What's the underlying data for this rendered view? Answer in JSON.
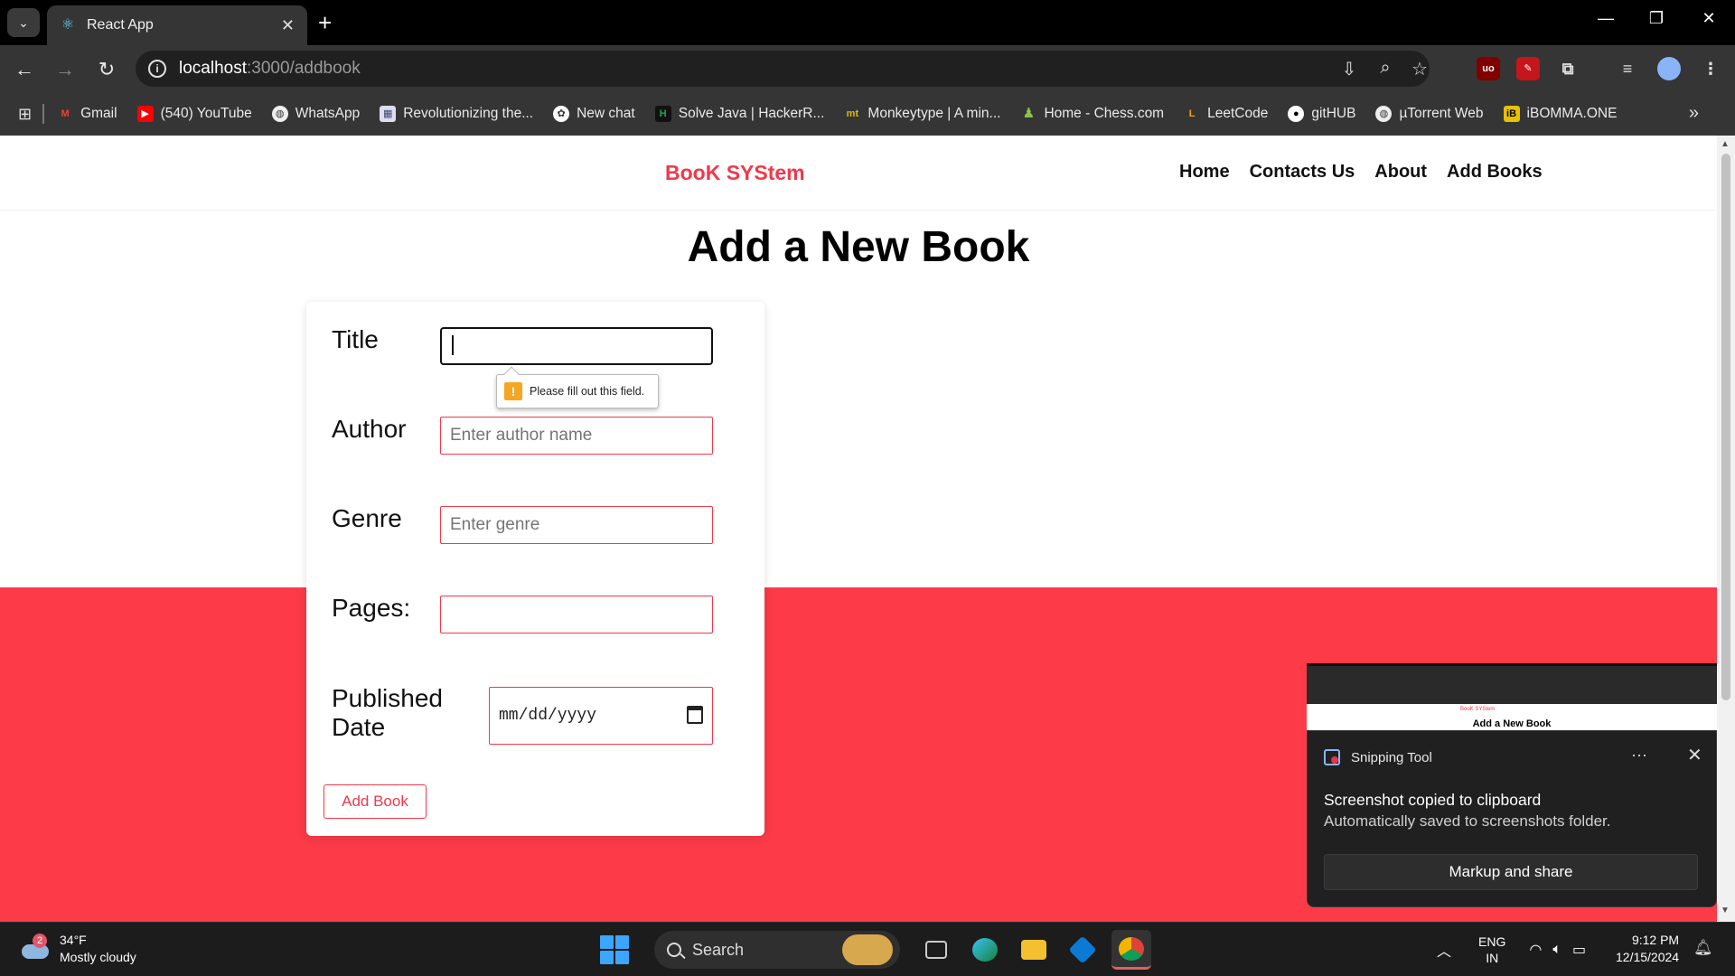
{
  "browser": {
    "tab_title": "React App",
    "url_host": "localhost",
    "url_rest": ":3000/addbook",
    "bookmarks": [
      {
        "label": "Gmail",
        "icon": "gmail-icon",
        "color": "#ea4335",
        "glyph": "M"
      },
      {
        "label": "(540) YouTube",
        "icon": "youtube-icon",
        "color": "#ff0000",
        "glyph": "▶"
      },
      {
        "label": "WhatsApp",
        "icon": "globe-icon",
        "color": "#555",
        "glyph": "◍"
      },
      {
        "label": "Revolutionizing the...",
        "icon": "site-icon",
        "color": "#3b4a7a",
        "glyph": "▦"
      },
      {
        "label": "New chat",
        "icon": "chatgpt-icon",
        "color": "#444",
        "glyph": "✿"
      },
      {
        "label": "Solve Java | HackerR...",
        "icon": "hackerrank-icon",
        "color": "#1ba94c",
        "glyph": "H"
      },
      {
        "label": "Monkeytype | A min...",
        "icon": "monkeytype-icon",
        "color": "#b58900",
        "glyph": "mt"
      },
      {
        "label": "Home - Chess.com",
        "icon": "chess-icon",
        "color": "#769656",
        "glyph": "♟"
      },
      {
        "label": "LeetCode",
        "icon": "leetcode-icon",
        "color": "#f89f1b",
        "glyph": "L"
      },
      {
        "label": "gitHUB",
        "icon": "github-icon",
        "color": "#444",
        "glyph": "●"
      },
      {
        "label": "µTorrent Web",
        "icon": "globe-icon",
        "color": "#555",
        "glyph": "◍"
      },
      {
        "label": "iBOMMA.ONE",
        "icon": "ibomma-icon",
        "color": "#e5c100",
        "glyph": "iB"
      }
    ]
  },
  "app": {
    "brand": "BooK SYStem",
    "nav": [
      "Home",
      "Contacts Us",
      "About",
      "Add Books"
    ],
    "heading": "Add a New Book",
    "form": {
      "title_label": "Title",
      "author_label": "Author",
      "author_placeholder": "Enter author name",
      "genre_label": "Genre",
      "genre_placeholder": "Enter genre",
      "pages_label": "Pages:",
      "date_label_1": "Published",
      "date_label_2": "Date",
      "date_placeholder": "mm/dd/yyyy",
      "submit_label": "Add Book",
      "validation_message": "Please fill out this field."
    },
    "colors": {
      "accent": "#f0394a",
      "band": "#fc3a48"
    }
  },
  "snip": {
    "thumb_brand": "BooK SYStem",
    "thumb_heading": "Add a New Book",
    "app_name": "Snipping Tool",
    "title": "Screenshot copied to clipboard",
    "body": "Automatically saved to screenshots folder.",
    "button": "Markup and share"
  },
  "taskbar": {
    "weather_badge": "2",
    "temp": "34°F",
    "condition": "Mostly cloudy",
    "search_label": "Search",
    "lang_1": "ENG",
    "lang_2": "IN",
    "time": "9:12 PM",
    "date": "12/15/2024"
  }
}
